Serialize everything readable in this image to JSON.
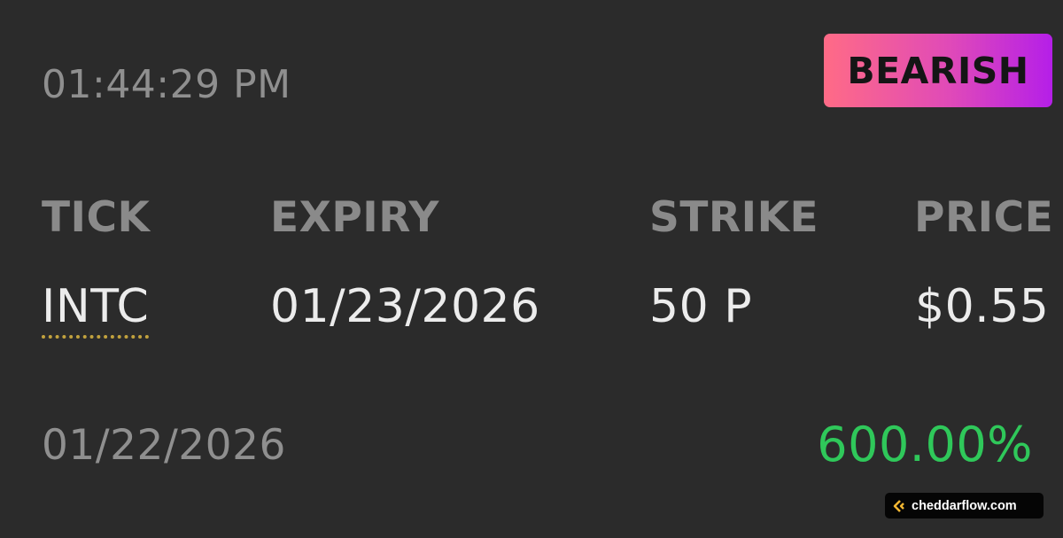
{
  "alert": {
    "time": "01:44:29 PM",
    "sentiment": "BEARISH",
    "date": "01/22/2026",
    "percent_change": "600.00%"
  },
  "columns": {
    "tick": "TICK",
    "expiry": "EXPIRY",
    "strike": "STRIKE",
    "price": "PRICE"
  },
  "row": {
    "tick": "INTC",
    "expiry": "01/23/2026",
    "strike": "50 P",
    "price": "$0.55"
  },
  "watermark": {
    "text": "cheddarflow.com",
    "icon": "cheddarflow-logo-icon"
  },
  "colors": {
    "background": "#2b2b2b",
    "badge_gradient_start": "#ff6b86",
    "badge_gradient_end": "#b51fe8",
    "positive": "#2fc85a",
    "ticker_underline": "#c2a23e"
  }
}
